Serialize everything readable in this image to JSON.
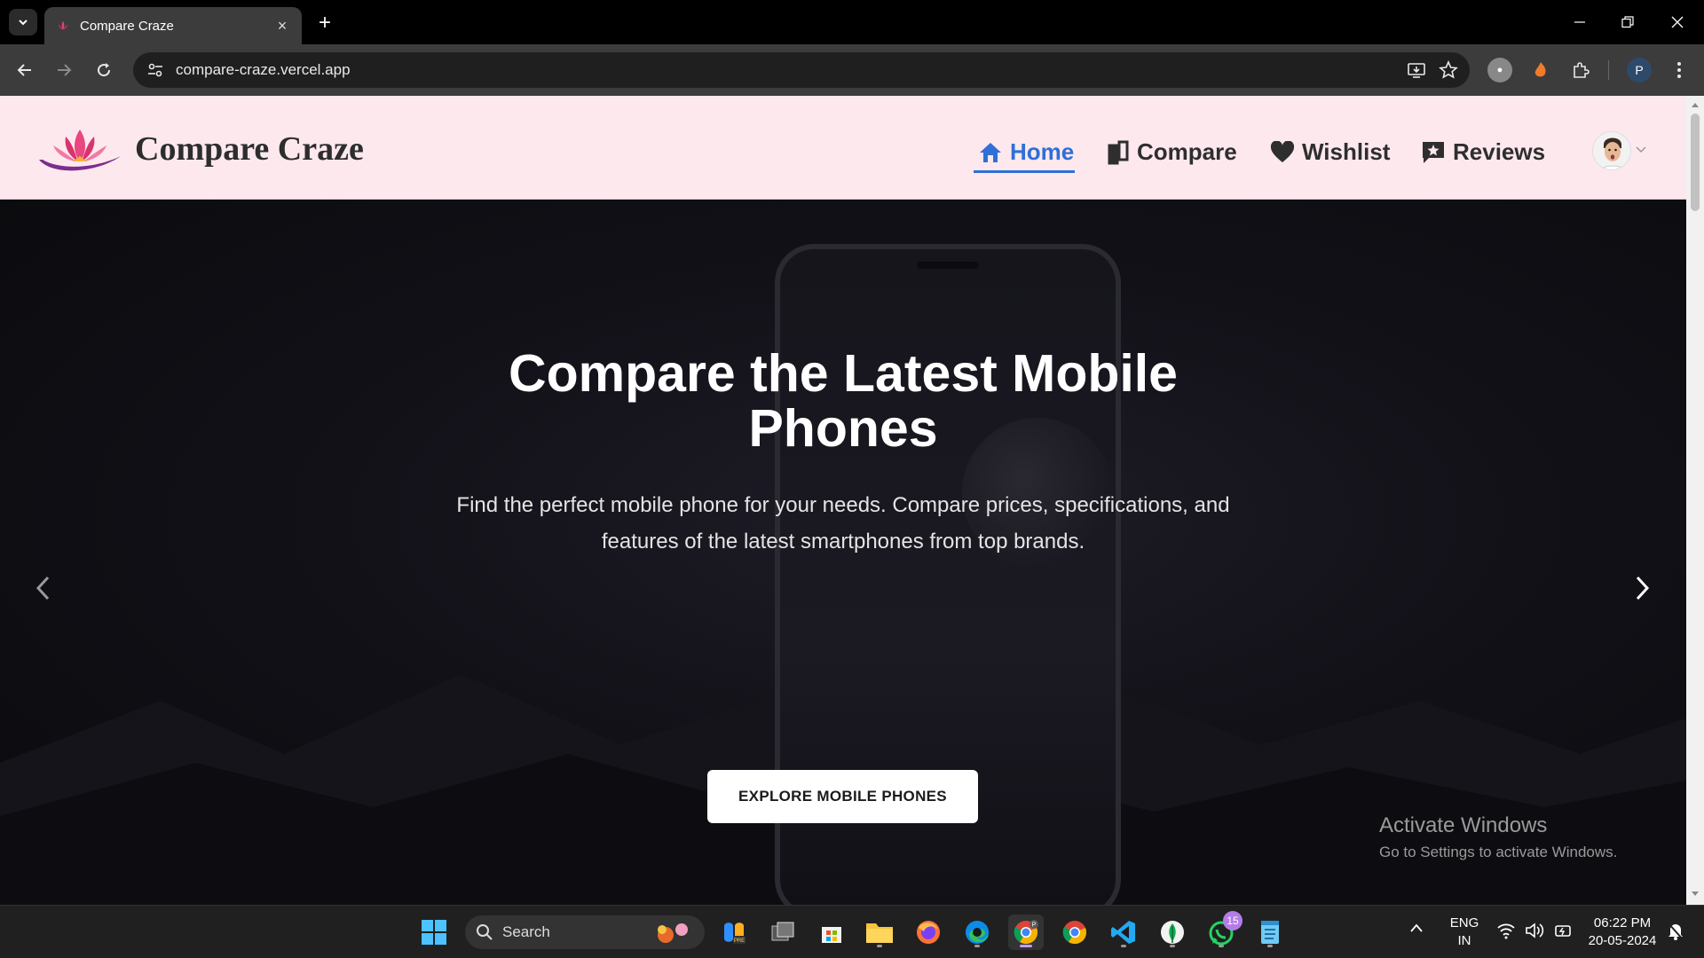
{
  "browser": {
    "tab_title": "Compare Craze",
    "url": "compare-craze.vercel.app",
    "profile_initial": "P"
  },
  "site": {
    "brand": "Compare Craze",
    "nav": [
      {
        "label": "Home",
        "icon": "home-icon",
        "active": true
      },
      {
        "label": "Compare",
        "icon": "compare-icon",
        "active": false
      },
      {
        "label": "Wishlist",
        "icon": "heart-icon",
        "active": false
      },
      {
        "label": "Reviews",
        "icon": "reviews-icon",
        "active": false
      }
    ],
    "accent_color": "#2f6fd6",
    "header_bg": "#fde8ee"
  },
  "hero": {
    "title": "Compare the Latest Mobile Phones",
    "subtitle": "Find the perfect mobile phone for your needs. Compare prices, specifications, and features of the latest smartphones from top brands.",
    "cta_label": "EXPLORE MOBILE PHONES"
  },
  "watermark": {
    "title": "Activate Windows",
    "subtitle": "Go to Settings to activate Windows."
  },
  "taskbar": {
    "search_placeholder": "Search",
    "whatsapp_badge": "15",
    "language": "ENG",
    "region": "IN",
    "time": "06:22 PM",
    "date": "20-05-2024"
  }
}
